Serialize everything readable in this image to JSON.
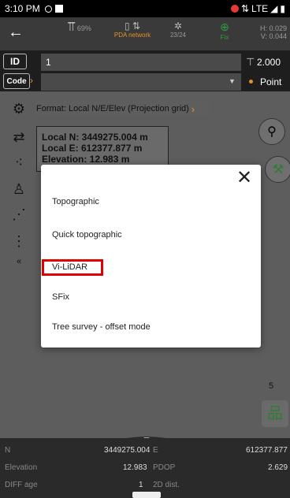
{
  "status_bar": {
    "time": "3:10 PM",
    "network": "LTE"
  },
  "toolbar": {
    "back": "←",
    "battery_pct": "69%",
    "link_label": "PDA network",
    "sats": "23/24",
    "fix": "Fix",
    "h_precision": "H: 0.029",
    "v_precision": "V: 0.044"
  },
  "point_rows": {
    "id_label": "ID",
    "id_value": "1",
    "height_value": "2.000",
    "code_label": "Code",
    "type_value": "Point"
  },
  "format_bar": {
    "text": "Format: Local N/E/Elev (Projection grid)"
  },
  "coords": {
    "n": "Local N: 3449275.004 m",
    "e": "Local E: 612377.877 m",
    "elev": "Elevation: 12.983 m"
  },
  "right_badge": "5",
  "bottom_info": {
    "n_label": "N",
    "n_value": "3449275.004",
    "e_label": "E",
    "e_value": "612377.877",
    "elev_label": "Elevation",
    "elev_value": "12.983",
    "pdop_label": "PDOP",
    "pdop_value": "2.629",
    "diff_label": "DIFF age",
    "diff_value": "1",
    "dist_label": "2D dist."
  },
  "dialog": {
    "close": "✕",
    "options": [
      "Topographic",
      "Quick topographic",
      "Vi-LiDAR",
      "SFix",
      "Tree survey - offset mode"
    ]
  }
}
